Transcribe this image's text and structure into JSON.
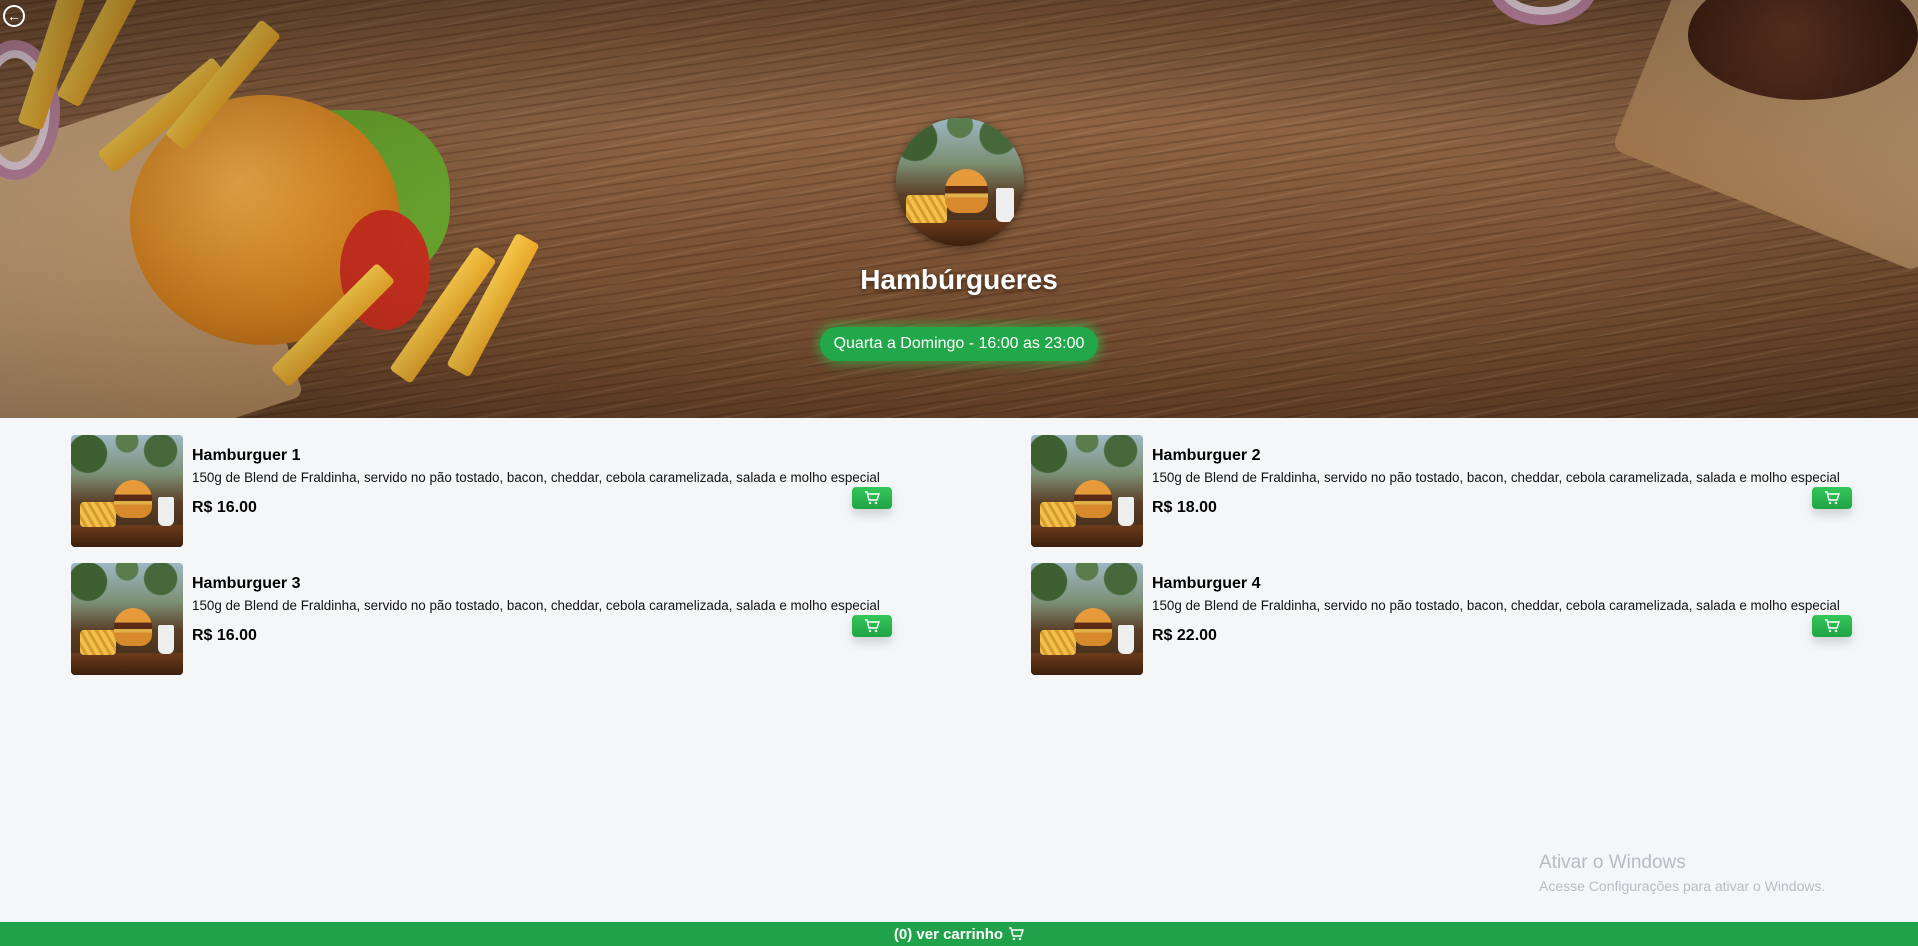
{
  "header": {
    "back_icon": "arrow-left-circle-icon",
    "title": "Hambúrgueres",
    "hours": "Quarta a Domingo - 16:00 as 23:00",
    "logo_icon": "burger-logo"
  },
  "menu": {
    "items": [
      {
        "name": "Hamburguer 1",
        "description": "150g de Blend de Fraldinha, servido no pão tostado, bacon, cheddar, cebola caramelizada, salada e molho especial",
        "price": "R$ 16.00"
      },
      {
        "name": "Hamburguer 2",
        "description": "150g de Blend de Fraldinha, servido no pão tostado, bacon, cheddar, cebola caramelizada, salada e molho especial",
        "price": "R$ 18.00"
      },
      {
        "name": "Hamburguer 3",
        "description": "150g de Blend de Fraldinha, servido no pão tostado, bacon, cheddar, cebola caramelizada, salada e molho especial",
        "price": "R$ 16.00"
      },
      {
        "name": "Hamburguer 4",
        "description": "150g de Blend de Fraldinha, servido no pão tostado, bacon, cheddar, cebola caramelizada, salada e molho especial",
        "price": "R$ 22.00"
      }
    ],
    "add_icon": "cart-icon"
  },
  "watermark": {
    "line1": "Ativar o Windows",
    "line2": "Acesse Configurações para ativar o Windows."
  },
  "footer": {
    "label": "(0) ver carrinho",
    "icon": "cart-icon"
  },
  "colors": {
    "accent": "#1fa24a",
    "button": "#2cbf55",
    "background": "#f5f6f8"
  }
}
